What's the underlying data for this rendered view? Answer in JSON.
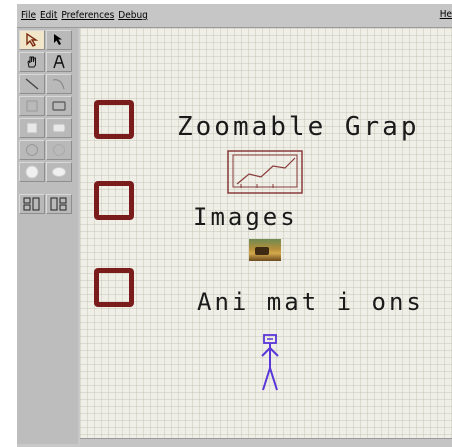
{
  "menubar": {
    "items": [
      {
        "label": "File"
      },
      {
        "label": "Edit"
      },
      {
        "label": "Preferences"
      },
      {
        "label": "Debug"
      }
    ],
    "help_label": "He"
  },
  "toolbar": {
    "tools": [
      "selection-icon",
      "arrow-icon",
      "hand-icon",
      "text-icon",
      "line-icon",
      "polyline-icon",
      "rectangle-icon",
      "rounded-rectangle-icon",
      "filled-rectangle-icon",
      "filled-rounded-rectangle-icon",
      "ellipse-icon",
      "rounded-ellipse-icon",
      "filled-circle-icon",
      "filled-ellipse-icon",
      "group-icon",
      "ungroup-icon"
    ]
  },
  "canvas": {
    "items": [
      {
        "label": "Zoomable Grap",
        "thumbnail": "graph-thumbnail-icon"
      },
      {
        "label": "Images",
        "thumbnail": "image-thumbnail"
      },
      {
        "label": "Ani mat i ons",
        "thumbnail": "stick-figure-icon"
      }
    ]
  },
  "colors": {
    "portal_border": "#7a1c1c",
    "canvas_background": "#efefe8",
    "figure_stroke": "#5a36d8",
    "graph_stroke": "#8a3a3a"
  }
}
